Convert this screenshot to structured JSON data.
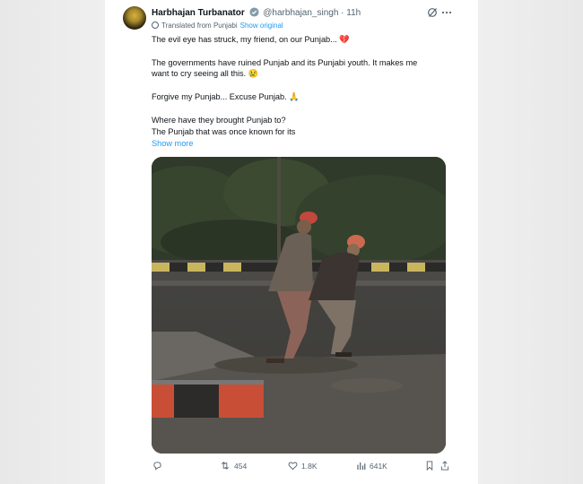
{
  "tweet": {
    "author_name": "Harbhajan Turbanator",
    "handle": "@harbhajan_singh",
    "separator": "·",
    "time": "11h",
    "translated_label": "Translated from Punjabi",
    "show_original_label": "Show original",
    "lines": [
      "The evil eye has struck, my friend, on our Punjab... 💔",
      "The governments have ruined Punjab and its Punjabi youth. It makes me",
      "want to cry seeing all this. 😢",
      "Forgive my Punjab... Excuse Punjab. 🙏",
      "Where have they brought Punjab to?",
      "The Punjab that was once known for its"
    ],
    "show_more_label": "Show more"
  },
  "actions": {
    "retweets": "454",
    "likes": "1.8K",
    "views": "641K"
  },
  "colors": {
    "accent": "#1d9bf0",
    "text": "#0f1419",
    "muted": "#536471"
  }
}
